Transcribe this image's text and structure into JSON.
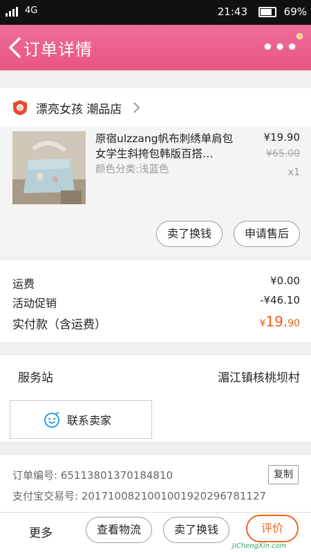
{
  "status_bar": {
    "network": "4G",
    "time": "21:43",
    "battery": "69%",
    "battery_level": 0.69
  },
  "header": {
    "title": "订单详情",
    "more_icon": "more-dots-icon",
    "notification_dot_color": "#f7d16a"
  },
  "store": {
    "name": "漂亮女孩 潮品店"
  },
  "product": {
    "title": "原宿ulzzang帆布刺绣单肩包女学生斜挎包韩版百搭…",
    "variant": "颜色分类:浅蓝色",
    "price": "¥19.90",
    "original_price": "¥65.00",
    "quantity": "x1",
    "buttons": {
      "sell": "卖了换钱",
      "after_sales": "申请售后"
    }
  },
  "totals": {
    "shipping_label": "运费",
    "shipping_value": "¥0.00",
    "promo_label": "活动促销",
    "promo_value": "-¥46.10",
    "paid_label": "实付款（含运费）",
    "paid_symbol": "¥",
    "paid_int": "19.",
    "paid_dec": "90"
  },
  "service": {
    "label": "服务站",
    "value": "湄江镇核桃坝村",
    "contact_label": "联系卖家"
  },
  "order_info": {
    "order_no": "订单编号: 65113801370184810",
    "alipay_no": "支付宝交易号: 2017100821001001920296781127",
    "copy_label": "复制"
  },
  "bottom_bar": {
    "more": "更多",
    "logistics": "查看物流",
    "sell": "卖了换钱",
    "review": "评价"
  },
  "watermark": "JiChengXin.com",
  "colors": {
    "brand": "#e9567f",
    "accent": "#f05a16"
  }
}
